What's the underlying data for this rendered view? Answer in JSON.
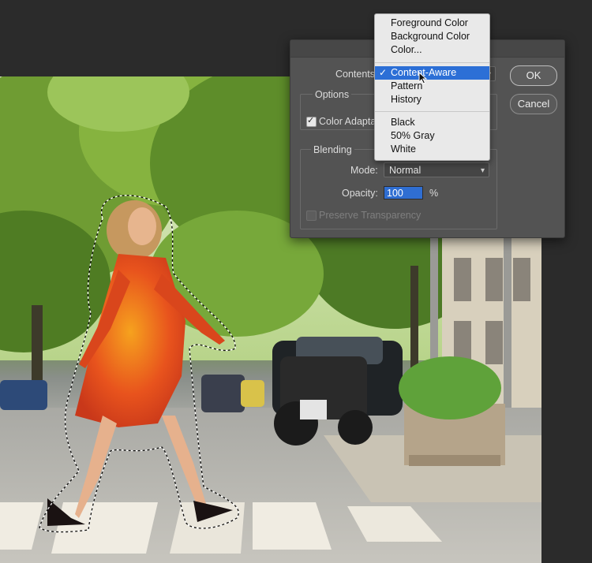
{
  "dialog": {
    "contents_label": "Contents:",
    "options_title": "Options",
    "color_adaptation_label": "Color Adaptation",
    "blending_title": "Blending",
    "mode_label": "Mode:",
    "mode_value": "Normal",
    "opacity_label": "Opacity:",
    "opacity_value": "100",
    "opacity_unit": "%",
    "preserve_transparency_label": "Preserve Transparency",
    "ok_label": "OK",
    "cancel_label": "Cancel"
  },
  "menu": {
    "items": [
      "Foreground Color",
      "Background Color",
      "Color...",
      "Content-Aware",
      "Pattern",
      "History",
      "Black",
      "50% Gray",
      "White"
    ],
    "selected": "Content-Aware",
    "check_mark": "✓"
  },
  "colors": {
    "highlight": "#2c6fd6",
    "dialog_bg": "#535353",
    "app_bg": "#2b2b2b"
  }
}
